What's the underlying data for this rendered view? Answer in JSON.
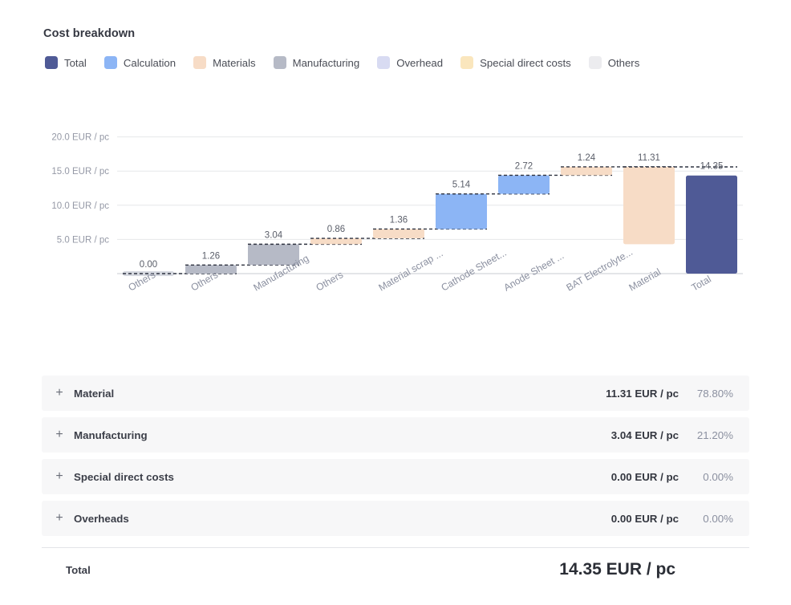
{
  "header": {
    "title": "Cost breakdown"
  },
  "legend": {
    "items": [
      {
        "label": "Total",
        "color": "#4f5a96"
      },
      {
        "label": "Calculation",
        "color": "#8cb5f5"
      },
      {
        "label": "Materials",
        "color": "#f7dcc6"
      },
      {
        "label": "Manufacturing",
        "color": "#b6bac6"
      },
      {
        "label": "Overhead",
        "color": "#d8dbf2"
      },
      {
        "label": "Special direct costs",
        "color": "#fae6bd"
      },
      {
        "label": "Others",
        "color": "#ececef"
      }
    ]
  },
  "chart_data": {
    "type": "bar",
    "subtype": "waterfall",
    "title": "Cost breakdown",
    "xlabel": "",
    "ylabel": "EUR / pc",
    "unit": "EUR / pc",
    "ylim": [
      0,
      21.0
    ],
    "yticks": [
      5.0,
      10.0,
      15.0,
      20.0
    ],
    "ytick_labels": [
      "5.0 EUR / pc",
      "10.0 EUR / pc",
      "15.0 EUR / pc",
      "20.0 EUR / pc"
    ],
    "grid": true,
    "legend_position": "top-left",
    "categories": [
      "Others",
      "Others",
      "Manufacturing",
      "Others",
      "Material scrap ...",
      "Cathode Sheet...",
      "Anode Sheet ...",
      "BAT Electrolyte...",
      "Material",
      "Total"
    ],
    "values": [
      0.0,
      1.26,
      3.04,
      0.86,
      1.36,
      5.14,
      2.72,
      1.24,
      11.31,
      14.35
    ],
    "value_labels": [
      "0.00",
      "1.26",
      "3.04",
      "0.86",
      "1.36",
      "5.14",
      "2.72",
      "1.24",
      "11.31",
      "14.35"
    ],
    "bases": [
      0.0,
      0.0,
      1.26,
      4.3,
      5.16,
      6.52,
      11.66,
      14.38,
      4.3,
      0.0
    ],
    "tops": [
      0.0,
      1.26,
      4.3,
      5.16,
      6.52,
      11.66,
      14.38,
      15.62,
      15.61,
      14.35
    ],
    "series_colors": [
      "#d6d9e0",
      "#b6bac6",
      "#b6bac6",
      "#f7dcc6",
      "#f7dcc6",
      "#8cb5f5",
      "#8cb5f5",
      "#f7dcc6",
      "#f7dcc6",
      "#4f5a96"
    ],
    "measure": [
      "relative",
      "relative",
      "relative",
      "relative",
      "relative",
      "relative",
      "relative",
      "relative",
      "relative",
      "total"
    ]
  },
  "breakdown": {
    "rows": [
      {
        "expander": "+",
        "label": "Material",
        "value": "11.31 EUR / pc",
        "percent": "78.80%"
      },
      {
        "expander": "+",
        "label": "Manufacturing",
        "value": "3.04 EUR / pc",
        "percent": "21.20%"
      },
      {
        "expander": "+",
        "label": "Special direct costs",
        "value": "0.00 EUR / pc",
        "percent": "0.00%"
      },
      {
        "expander": "+",
        "label": "Overheads",
        "value": "0.00 EUR / pc",
        "percent": "0.00%"
      }
    ],
    "total": {
      "label": "Total",
      "value": "14.35 EUR / pc"
    }
  }
}
